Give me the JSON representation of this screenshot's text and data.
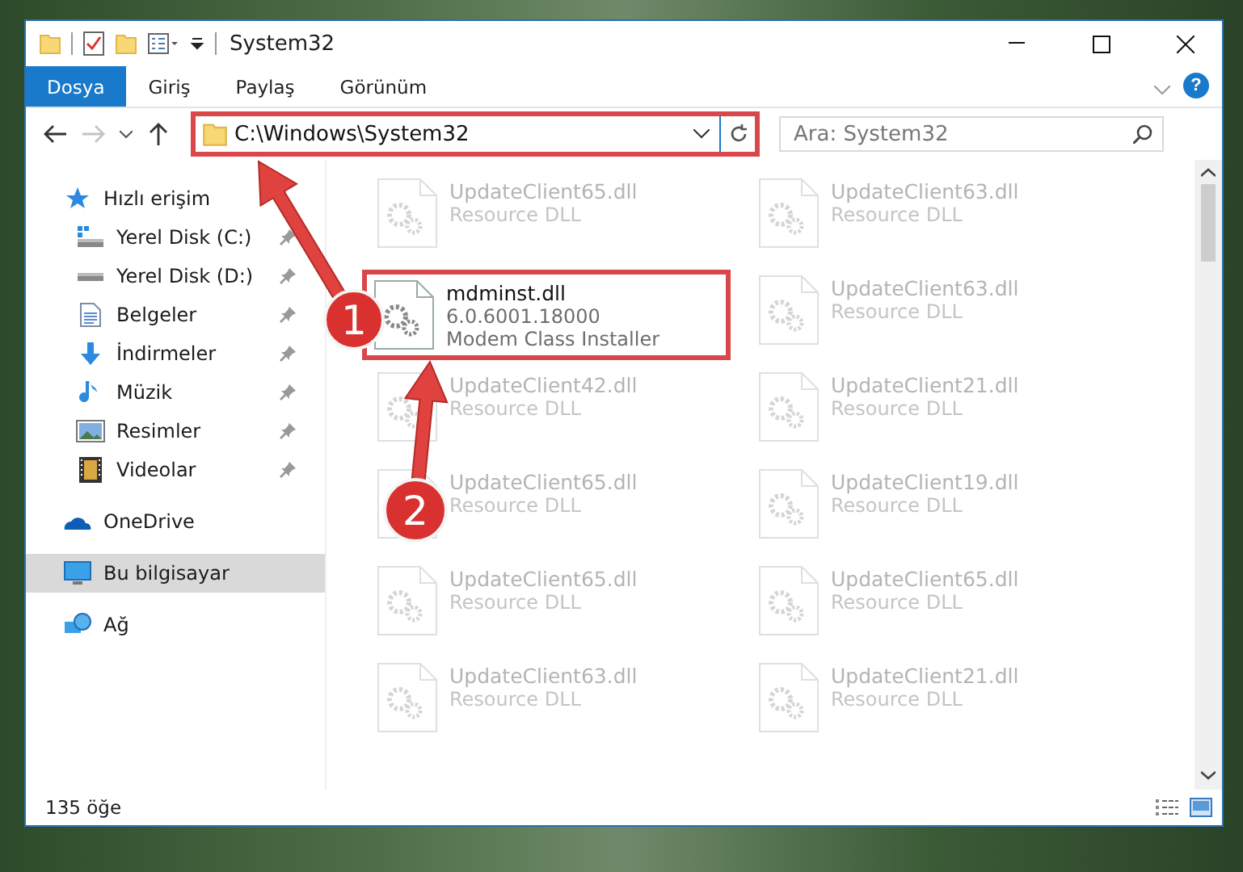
{
  "window": {
    "title": "System32"
  },
  "ribbon": {
    "tabs": [
      {
        "label": "Dosya",
        "selected": true
      },
      {
        "label": "Giriş",
        "selected": false
      },
      {
        "label": "Paylaş",
        "selected": false
      },
      {
        "label": "Görünüm",
        "selected": false
      }
    ],
    "help": "?"
  },
  "address_bar": {
    "path": "C:\\Windows\\System32",
    "highlighted": true,
    "forward_disabled": true
  },
  "search": {
    "placeholder": "Ara: System32"
  },
  "sidebar": {
    "items": [
      {
        "label": "Hızlı erişim",
        "kind": "star",
        "selected": false,
        "children": [
          {
            "label": "Yerel Disk (C:)",
            "kind": "drive-os",
            "pinned": true,
            "selected": false
          },
          {
            "label": "Yerel Disk (D:)",
            "kind": "drive",
            "pinned": true,
            "selected": false
          },
          {
            "label": "Belgeler",
            "kind": "document",
            "pinned": true,
            "selected": false
          },
          {
            "label": "İndirmeler",
            "kind": "download",
            "pinned": true,
            "selected": false
          },
          {
            "label": "Müzik",
            "kind": "music",
            "pinned": true,
            "selected": false
          },
          {
            "label": "Resimler",
            "kind": "picture",
            "pinned": true,
            "selected": false
          },
          {
            "label": "Videolar",
            "kind": "video",
            "pinned": true,
            "selected": false
          }
        ]
      },
      {
        "label": "OneDrive",
        "kind": "cloud",
        "selected": false
      },
      {
        "label": "Bu bilgisayar",
        "kind": "computer",
        "selected": true
      },
      {
        "label": "Ağ",
        "kind": "network",
        "selected": false
      }
    ]
  },
  "files": [
    {
      "name": "UpdateClient65.dll",
      "lines": [
        "Resource DLL"
      ],
      "faded": true,
      "highlighted": false
    },
    {
      "name": "UpdateClient63.dll",
      "lines": [
        "Resource DLL"
      ],
      "faded": true,
      "highlighted": false
    },
    {
      "name": "mdminst.dll",
      "lines": [
        "6.0.6001.18000",
        "Modem Class Installer"
      ],
      "faded": false,
      "highlighted": true
    },
    {
      "name": "UpdateClient63.dll",
      "lines": [
        "Resource DLL"
      ],
      "faded": true,
      "highlighted": false
    },
    {
      "name": "UpdateClient42.dll",
      "lines": [
        "Resource DLL"
      ],
      "faded": true,
      "highlighted": false
    },
    {
      "name": "UpdateClient21.dll",
      "lines": [
        "Resource DLL"
      ],
      "faded": true,
      "highlighted": false
    },
    {
      "name": "UpdateClient65.dll",
      "lines": [
        "Resource DLL"
      ],
      "faded": true,
      "highlighted": false
    },
    {
      "name": "UpdateClient19.dll",
      "lines": [
        "Resource DLL"
      ],
      "faded": true,
      "highlighted": false
    },
    {
      "name": "UpdateClient65.dll",
      "lines": [
        "Resource DLL"
      ],
      "faded": true,
      "highlighted": false
    },
    {
      "name": "UpdateClient65.dll",
      "lines": [
        "Resource DLL"
      ],
      "faded": true,
      "highlighted": false
    },
    {
      "name": "UpdateClient63.dll",
      "lines": [
        "Resource DLL"
      ],
      "faded": true,
      "highlighted": false
    },
    {
      "name": "UpdateClient21.dll",
      "lines": [
        "Resource DLL"
      ],
      "faded": true,
      "highlighted": false
    }
  ],
  "status_bar": {
    "item_count": "135 öğe"
  },
  "callouts": [
    {
      "number": "1"
    },
    {
      "number": "2"
    }
  ]
}
